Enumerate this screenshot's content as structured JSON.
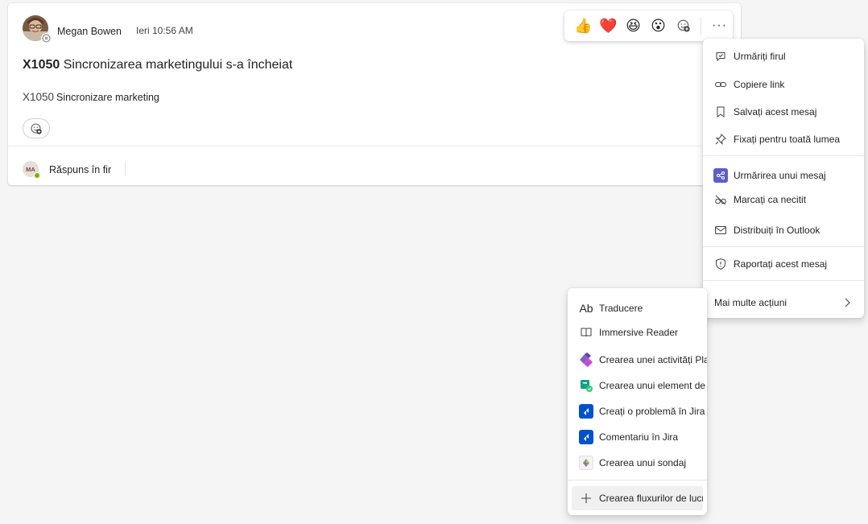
{
  "message": {
    "author": "Megan Bowen",
    "timestamp": "Ieri 10:56 AM",
    "title_id": "X1050",
    "title_text": "Sincronizarea marketingului s-a încheiat",
    "body_id": "X1050",
    "body_text": "Sincronizare marketing",
    "reply_avatar_initials": "MA",
    "reply_label": "Răspuns în fir"
  },
  "reactions": {
    "emojis": [
      "👍",
      "❤️",
      "😆",
      "😮"
    ],
    "more_label": "···"
  },
  "main_menu": {
    "items": [
      {
        "label": "Urmăriți firul",
        "icon": "follow-thread-icon"
      },
      {
        "label": "Copiere link",
        "icon": "link-icon"
      },
      {
        "label": "Salvați acest mesaj",
        "icon": "bookmark-icon"
      },
      {
        "label": "Fixați pentru toată lumea",
        "icon": "pin-icon"
      },
      {
        "label": "Urmărirea unui mesaj",
        "icon": "share-app-icon"
      },
      {
        "label": "Marcați ca necitit",
        "icon": "unread-icon"
      },
      {
        "label": "Distribuiți în Outlook",
        "icon": "mail-icon"
      },
      {
        "label": "Raportați acest mesaj",
        "icon": "shield-icon"
      },
      {
        "label": "Mai multe acțiuni",
        "icon": "chevron-right-icon"
      }
    ]
  },
  "sub_menu": {
    "items": [
      {
        "label": "Traducere",
        "icon": "translate-icon",
        "icon_text": "Ab"
      },
      {
        "label": "Immersive Reader",
        "icon": "immersive-reader-icon"
      },
      {
        "label": "Crearea unei activități Planner",
        "icon": "planner-icon"
      },
      {
        "label": "Crearea unui element de lucru",
        "icon": "work-item-icon"
      },
      {
        "label": "Creați o problemă în Jira",
        "icon": "jira-icon"
      },
      {
        "label": "Comentariu în Jira",
        "icon": "jira-icon"
      },
      {
        "label": "Crearea unui sondaj",
        "icon": "forms-icon"
      },
      {
        "label": "Crearea fluxurilor de lucru",
        "icon": "plus-icon"
      }
    ]
  }
}
